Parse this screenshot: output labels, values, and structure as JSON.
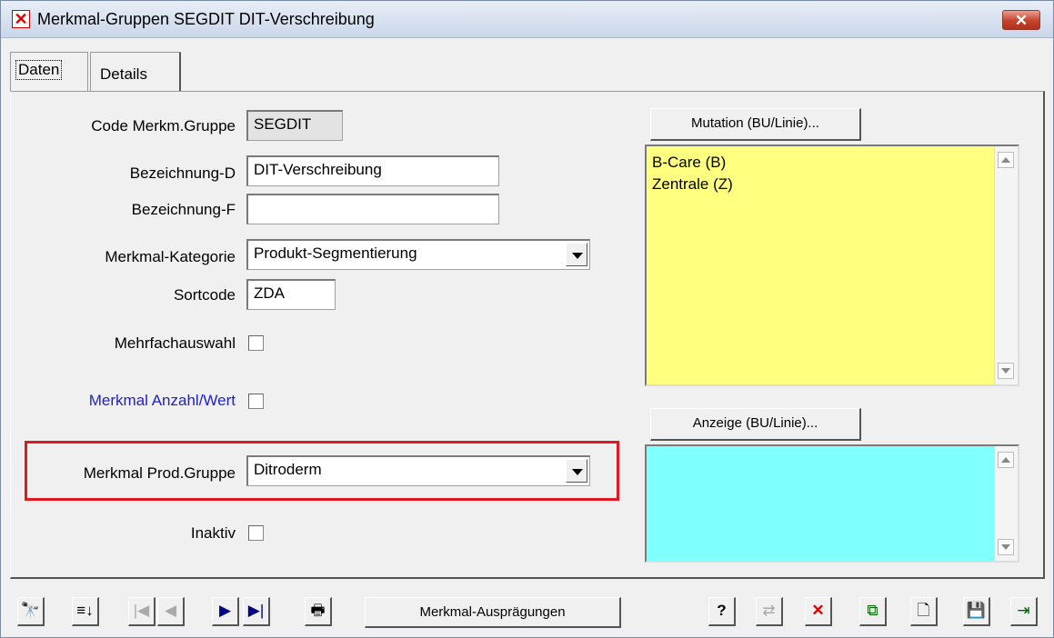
{
  "window": {
    "title": "Merkmal-Gruppen  SEGDIT  DIT-Verschreibung",
    "app_icon": "✕",
    "close_label": "✕"
  },
  "tabs": [
    {
      "label": "Daten",
      "active": true
    },
    {
      "label": "Details",
      "active": false
    }
  ],
  "form": {
    "code_label": "Code Merkm.Gruppe",
    "code_value": "SEGDIT",
    "bez_d_label": "Bezeichnung-D",
    "bez_d_value": "DIT-Verschreibung",
    "bez_f_label": "Bezeichnung-F",
    "bez_f_value": "",
    "kategorie_label": "Merkmal-Kategorie",
    "kategorie_value": "Produkt-Segmentierung",
    "sortcode_label": "Sortcode",
    "sortcode_value": "ZDA",
    "mehrfach_label": "Mehrfachauswahl",
    "mehrfach_checked": false,
    "anzahl_label": "Merkmal Anzahl/Wert",
    "anzahl_checked": false,
    "prodgruppe_label": "Merkmal Prod.Gruppe",
    "prodgruppe_value": "Ditroderm",
    "inaktiv_label": "Inaktiv",
    "inaktiv_checked": false
  },
  "mutation": {
    "button_label": "Mutation (BU/Linie)...",
    "items": [
      "B-Care  (B)",
      "Zentrale  (Z)"
    ],
    "bg_color": "#ffff80"
  },
  "anzeige": {
    "button_label": "Anzeige (BU/Linie)...",
    "items": [],
    "bg_color": "#80ffff"
  },
  "colors": {
    "highlight": "#e0191e",
    "link_label": "#1f1fd0"
  },
  "toolbar": {
    "search_icon": "🔭",
    "sort_icon": "≡↓",
    "first_icon": "|◀",
    "prev_icon": "◀",
    "next_icon": "▶",
    "last_icon": "▶|",
    "print_icon": "🖶",
    "merkmal_button_label": "Merkmal-Ausprägungen",
    "help_icon": "?",
    "swap_icon": "⇄",
    "delete_icon": "✕",
    "copy_icon": "⧉",
    "new_icon": "🗋",
    "save_icon": "💾",
    "exit_icon": "⇥"
  }
}
